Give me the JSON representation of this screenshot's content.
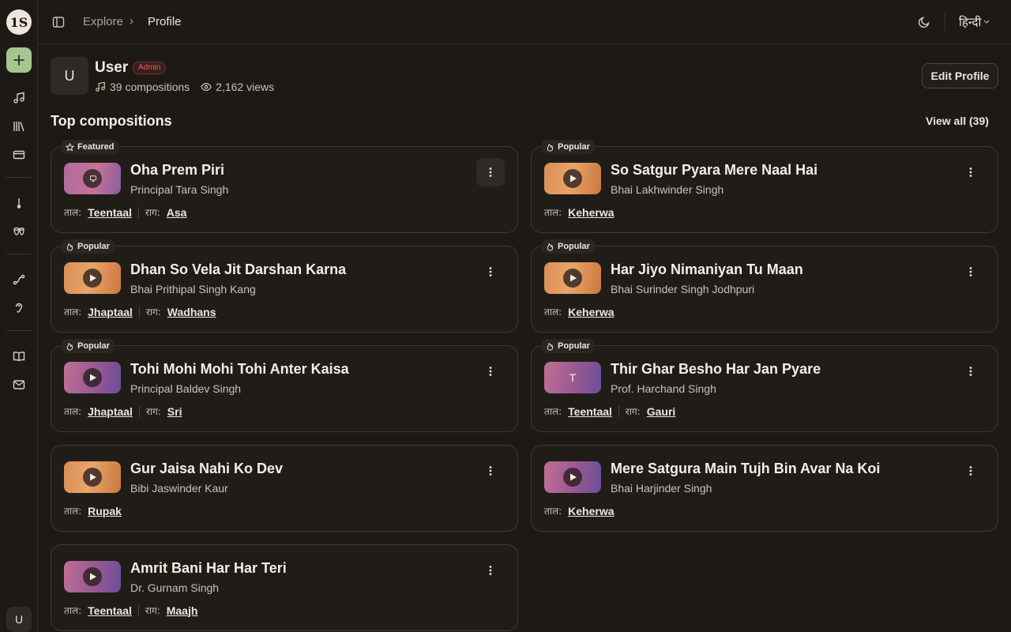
{
  "sidebar": {
    "logo_text": "1S",
    "new_icon": "plus-icon",
    "items": [
      {
        "name": "music-note-icon"
      },
      {
        "name": "library-icon"
      },
      {
        "name": "card-icon"
      },
      {
        "name": "tuner-icon"
      },
      {
        "name": "tabla-icon"
      },
      {
        "name": "route-icon"
      },
      {
        "name": "ear-icon"
      },
      {
        "name": "book-icon"
      },
      {
        "name": "mail-icon"
      }
    ],
    "user_initial": "U"
  },
  "header": {
    "breadcrumb": {
      "parent": "Explore",
      "separator": "›",
      "current": "Profile"
    },
    "language": "हिन्दी"
  },
  "profile": {
    "initial": "U",
    "name": "User",
    "badge": "Admin",
    "compositions": "39 compositions",
    "views": "2,162 views",
    "edit_label": "Edit Profile"
  },
  "section": {
    "title": "Top compositions",
    "view_all": "View all (39)"
  },
  "labels": {
    "taal": "ताल:",
    "raag": "राग:"
  },
  "cards": [
    {
      "tag": "Featured",
      "title": "Oha Prem Piri",
      "artist": "Principal Tara Singh",
      "taal": "Teentaal",
      "raag": "Asa"
    },
    {
      "tag": "Popular",
      "title": "So Satgur Pyara Mere Naal Hai",
      "artist": "Bhai Lakhwinder Singh",
      "taal": "Keherwa",
      "raag": ""
    },
    {
      "tag": "Popular",
      "title": "Dhan So Vela Jit Darshan Karna",
      "artist": "Bhai Prithipal Singh Kang",
      "taal": "Jhaptaal",
      "raag": "Wadhans"
    },
    {
      "tag": "Popular",
      "title": "Har Jiyo Nimaniyan Tu Maan",
      "artist": "Bhai Surinder Singh Jodhpuri",
      "taal": "Keherwa",
      "raag": ""
    },
    {
      "tag": "Popular",
      "title": "Tohi Mohi Mohi Tohi Anter Kaisa",
      "artist": "Principal Baldev Singh",
      "taal": "Jhaptaal",
      "raag": "Sri"
    },
    {
      "tag": "Popular",
      "title": "Thir Ghar Besho Har Jan Pyare",
      "artist": "Prof. Harchand Singh",
      "taal": "Teentaal",
      "raag": "Gauri",
      "thumb_letter": "T"
    },
    {
      "tag": "",
      "title": "Gur Jaisa Nahi Ko Dev",
      "artist": "Bibi Jaswinder Kaur",
      "taal": "Rupak",
      "raag": ""
    },
    {
      "tag": "",
      "title": "Mere Satgura Main Tujh Bin Avar Na Koi",
      "artist": "Bhai Harjinder Singh",
      "taal": "Keherwa",
      "raag": ""
    },
    {
      "tag": "",
      "title": "Amrit Bani Har Har Teri",
      "artist": "Dr. Gurnam Singh",
      "taal": "Teentaal",
      "raag": "Maajh"
    }
  ]
}
